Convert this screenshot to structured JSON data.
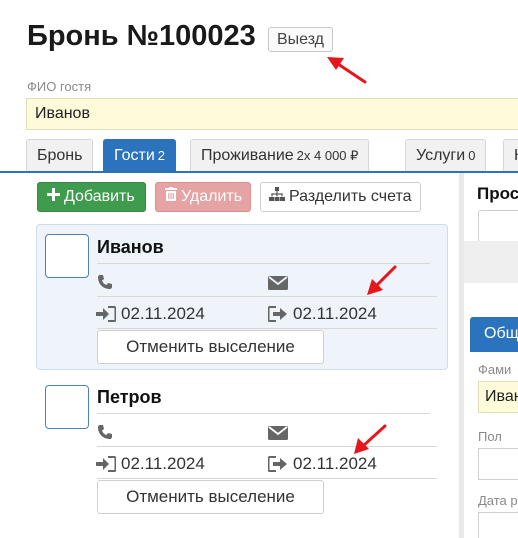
{
  "booking": {
    "title": "Бронь №100023",
    "status_button": "Выезд"
  },
  "guest_name": {
    "label": "ФИО гостя",
    "value": "Иванов"
  },
  "tabs": [
    {
      "label": "Бронь",
      "count": ""
    },
    {
      "label": "Гости",
      "count": "2"
    },
    {
      "label": "Проживание",
      "count": "2x 4 000 ₽"
    },
    {
      "label": "Услуги",
      "count": "0"
    },
    {
      "label": "К",
      "count": ""
    }
  ],
  "toolbar": {
    "add_label": "Добавить",
    "delete_label": "Удалить",
    "split_label": "Разделить счета"
  },
  "guests": [
    {
      "name": "Иванов",
      "checkin": "02.11.2024",
      "checkout": "02.11.2024",
      "action": "Отменить выселение"
    },
    {
      "name": "Петров",
      "checkin": "02.11.2024",
      "checkout": "02.11.2024",
      "action": "Отменить выселение"
    }
  ],
  "right_panel": {
    "heading": "Прос",
    "tab_label": "Общ",
    "field1_label": "Фами",
    "field1_value": "Иван",
    "field2_label": "Пол",
    "field3_label": "Дата р"
  },
  "colors": {
    "accent": "#2b73bd",
    "add_green": "#3f9c4e",
    "delete_disabled": "#e6a3a3",
    "highlight_field": "#fdfbd9",
    "annotation_arrow": "#e8161b"
  }
}
